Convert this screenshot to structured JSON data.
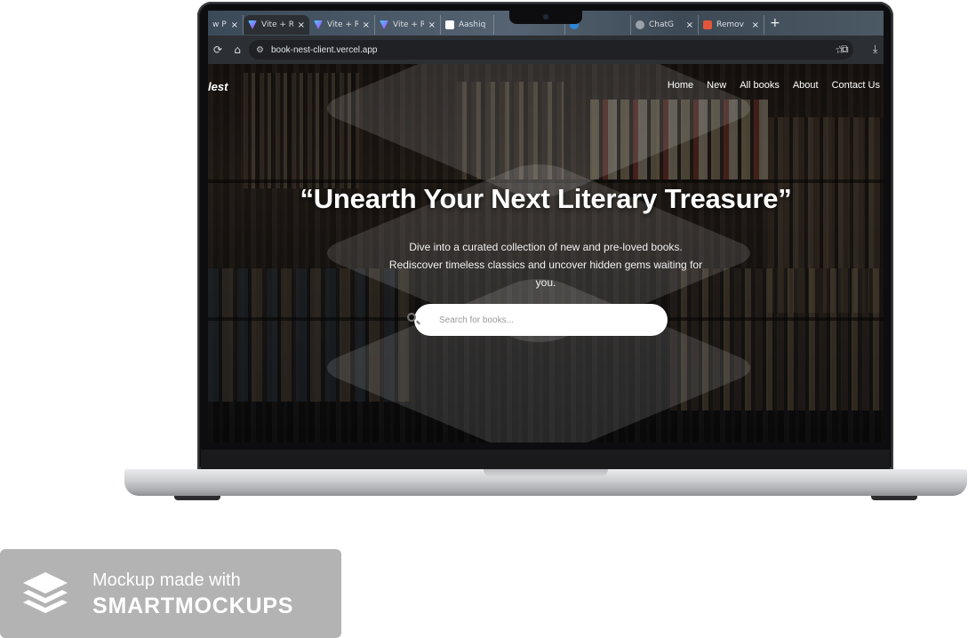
{
  "browser": {
    "tabs": [
      {
        "title": "w Pr",
        "icon": "page-icon",
        "active": false
      },
      {
        "title": "Vite + R",
        "icon": "vite-icon",
        "active": true
      },
      {
        "title": "Vite + R",
        "icon": "vite-icon",
        "active": false
      },
      {
        "title": "Vite + R",
        "icon": "vite-icon",
        "active": false
      },
      {
        "title": "Aashiq",
        "icon": "user-icon",
        "active": false
      },
      {
        "title": "",
        "icon": "globe-icon",
        "active": false
      },
      {
        "title": "",
        "icon": "blue-icon",
        "active": false
      },
      {
        "title": "ChatG",
        "icon": "chatgpt-icon",
        "active": false
      },
      {
        "title": "Remov",
        "icon": "remove-icon",
        "active": false
      }
    ],
    "close_glyph": "×",
    "new_tab_glyph": "+",
    "url": "book-nest-client.vercel.app"
  },
  "site": {
    "brand": "lest",
    "nav": [
      "Home",
      "New",
      "All books",
      "About",
      "Contact Us"
    ],
    "headline": "“Unearth Your Next Literary Treasure”",
    "subtitle": "Dive into a curated collection of new and pre-loved books. Rediscover timeless classics and uncover hidden gems waiting for you.",
    "search_placeholder": "Search for books..."
  },
  "watermark": {
    "line1": "Mockup made with",
    "line2": "SMARTMOCKUPS"
  }
}
